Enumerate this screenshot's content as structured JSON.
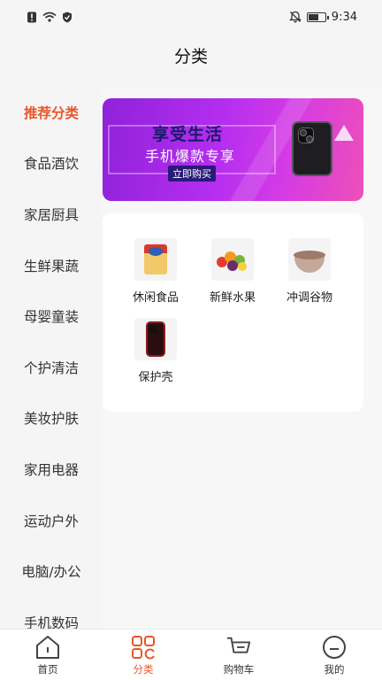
{
  "status_bar": {
    "time": "9:34",
    "left_icons": [
      "alert-icon",
      "wifi-icon",
      "shield-icon"
    ],
    "right_icons": [
      "mute-icon",
      "battery-icon"
    ]
  },
  "header": {
    "title": "分类"
  },
  "sidebar": {
    "items": [
      {
        "label": "推荐分类",
        "active": true
      },
      {
        "label": "食品酒饮",
        "active": false
      },
      {
        "label": "家居厨具",
        "active": false
      },
      {
        "label": "生鲜果蔬",
        "active": false
      },
      {
        "label": "母婴童装",
        "active": false
      },
      {
        "label": "个护清洁",
        "active": false
      },
      {
        "label": "美妆护肤",
        "active": false
      },
      {
        "label": "家用电器",
        "active": false
      },
      {
        "label": "运动户外",
        "active": false
      },
      {
        "label": "电脑/办公",
        "active": false
      },
      {
        "label": "手机数码",
        "active": false
      }
    ],
    "active_color": "#e8562a"
  },
  "banner": {
    "title": "享受生活",
    "subtitle": "手机爆款专享",
    "button": "立即购买",
    "colors": {
      "start": "#8f22d9",
      "end": "#ee4fb8"
    }
  },
  "categories": [
    {
      "label": "休闲食品",
      "icon": "snack-bag-icon"
    },
    {
      "label": "新鲜水果",
      "icon": "fruit-icon"
    },
    {
      "label": "冲调谷物",
      "icon": "cereal-bowl-icon"
    },
    {
      "label": "保护壳",
      "icon": "phone-case-icon"
    }
  ],
  "tabbar": {
    "tabs": [
      {
        "label": "首页",
        "icon": "home-icon",
        "active": false
      },
      {
        "label": "分类",
        "icon": "category-icon",
        "active": true
      },
      {
        "label": "购物车",
        "icon": "cart-icon",
        "active": false
      },
      {
        "label": "我的",
        "icon": "profile-icon",
        "active": false
      }
    ]
  }
}
